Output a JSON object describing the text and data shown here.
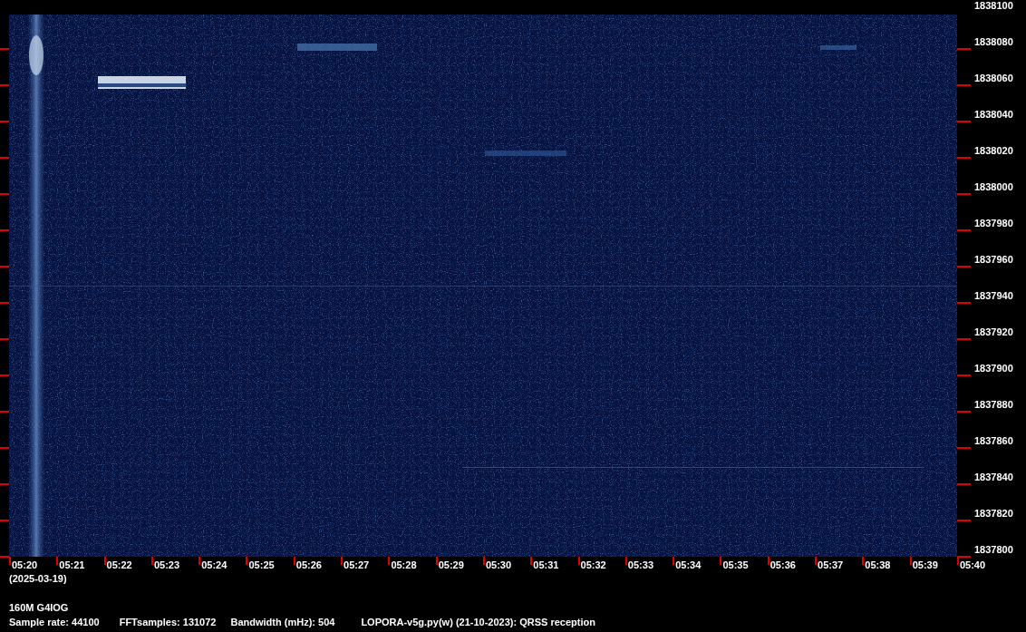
{
  "frequency_labels": [
    "1838100",
    "1838080",
    "1838060",
    "1838040",
    "1838020",
    "1838000",
    "1837980",
    "1837960",
    "1837940",
    "1837920",
    "1837900",
    "1837880",
    "1837860",
    "1837840",
    "1837820",
    "1837800"
  ],
  "time_labels": [
    "05:20",
    "05:21",
    "05:22",
    "05:23",
    "05:24",
    "05:25",
    "05:26",
    "05:27",
    "05:28",
    "05:29",
    "05:30",
    "05:31",
    "05:32",
    "05:33",
    "05:34",
    "05:35",
    "05:36",
    "05:37",
    "05:38",
    "05:39",
    "05:40"
  ],
  "date": "(2025-03-19)",
  "station": "160M G4IOG",
  "info": [
    "Sample rate: 44100",
    "FFTsamples: 131072",
    "Bandwidth (mHz): 504",
    "LOPORA-v5g.py(w) (21-10-2023): QRSS reception"
  ]
}
